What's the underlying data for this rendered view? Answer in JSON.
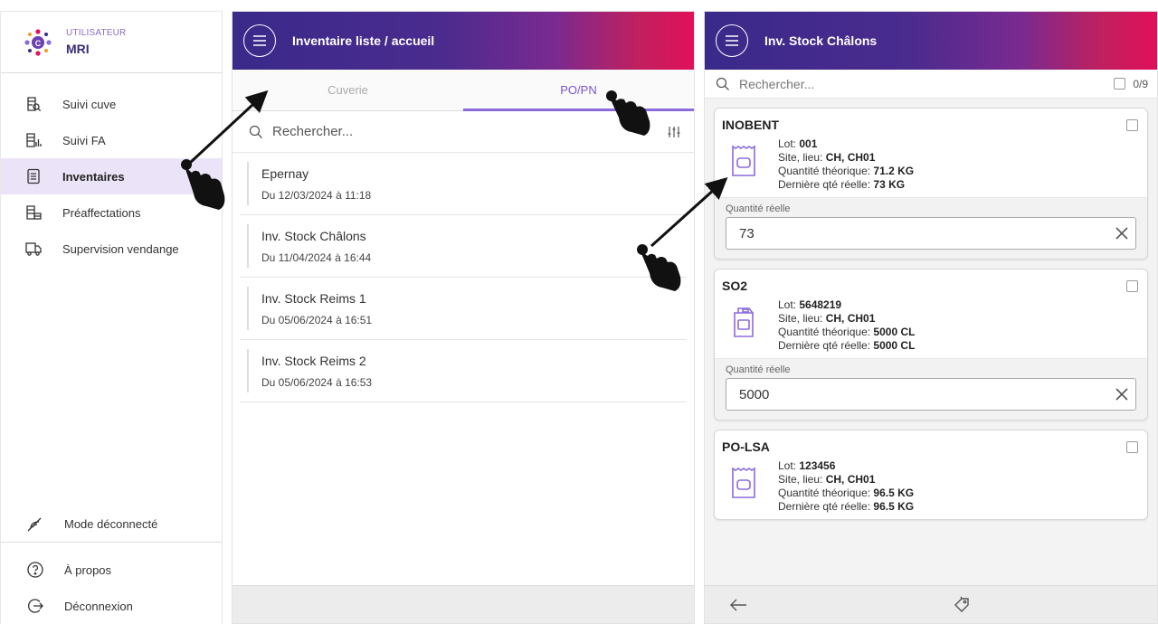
{
  "user": {
    "caption": "UTILISATEUR",
    "name": "MRI"
  },
  "sidebar": {
    "items": [
      {
        "label": "Suivi cuve",
        "icon": "tank-search-icon",
        "active": false
      },
      {
        "label": "Suivi FA",
        "icon": "tank-chart-icon",
        "active": false
      },
      {
        "label": "Inventaires",
        "icon": "inventory-list-icon",
        "active": true
      },
      {
        "label": "Préaffectations",
        "icon": "tank-assign-icon",
        "active": false
      },
      {
        "label": "Supervision vendange",
        "icon": "truck-icon",
        "active": false
      }
    ],
    "offline": {
      "label": "Mode déconnecté",
      "icon": "offline-icon"
    },
    "about": {
      "label": "À propos",
      "icon": "help-circle-icon"
    },
    "logout": {
      "label": "Déconnexion",
      "icon": "logout-icon"
    }
  },
  "middle": {
    "title": "Inventaire liste / accueil",
    "tabs": [
      {
        "label": "Cuverie"
      },
      {
        "label": "PO/PN"
      }
    ],
    "search_placeholder": "Rechercher...",
    "items": [
      {
        "title": "Epernay",
        "date": "Du 12/03/2024 à 11:18"
      },
      {
        "title": "Inv. Stock Châlons",
        "date": "Du 11/04/2024 à 16:44"
      },
      {
        "title": "Inv. Stock Reims 1",
        "date": "Du 05/06/2024 à 16:51"
      },
      {
        "title": "Inv. Stock Reims 2",
        "date": "Du 05/06/2024 à 16:53"
      }
    ]
  },
  "right": {
    "title": "Inv. Stock Châlons",
    "search_placeholder": "Rechercher...",
    "count": "0/9",
    "labels": {
      "lot": "Lot:",
      "site": "Site, lieu:",
      "qty_theo": "Quantité théorique:",
      "last_qty": "Dernière qté réelle:",
      "qty_real": "Quantité réelle"
    },
    "cards": [
      {
        "name": "INOBENT",
        "lot": "001",
        "site": "CH, CH01",
        "qty_theo": "71.2 KG",
        "last_qty": "73 KG",
        "qty_real": "73",
        "icon": "bag-icon"
      },
      {
        "name": "SO2",
        "lot": "5648219",
        "site": "CH, CH01",
        "qty_theo": "5000 CL",
        "last_qty": "5000 CL",
        "qty_real": "5000",
        "icon": "jerrycan-icon"
      },
      {
        "name": "PO-LSA",
        "lot": "123456",
        "site": "CH, CH01",
        "qty_theo": "96.5 KG",
        "last_qty": "96.5 KG",
        "qty_real": "",
        "icon": "bag-icon"
      }
    ]
  },
  "colors": {
    "accent": "#8b6bdc",
    "header_start": "#3a2a8a",
    "header_end": "#e0105a",
    "active_bg": "#ebe3f7"
  }
}
